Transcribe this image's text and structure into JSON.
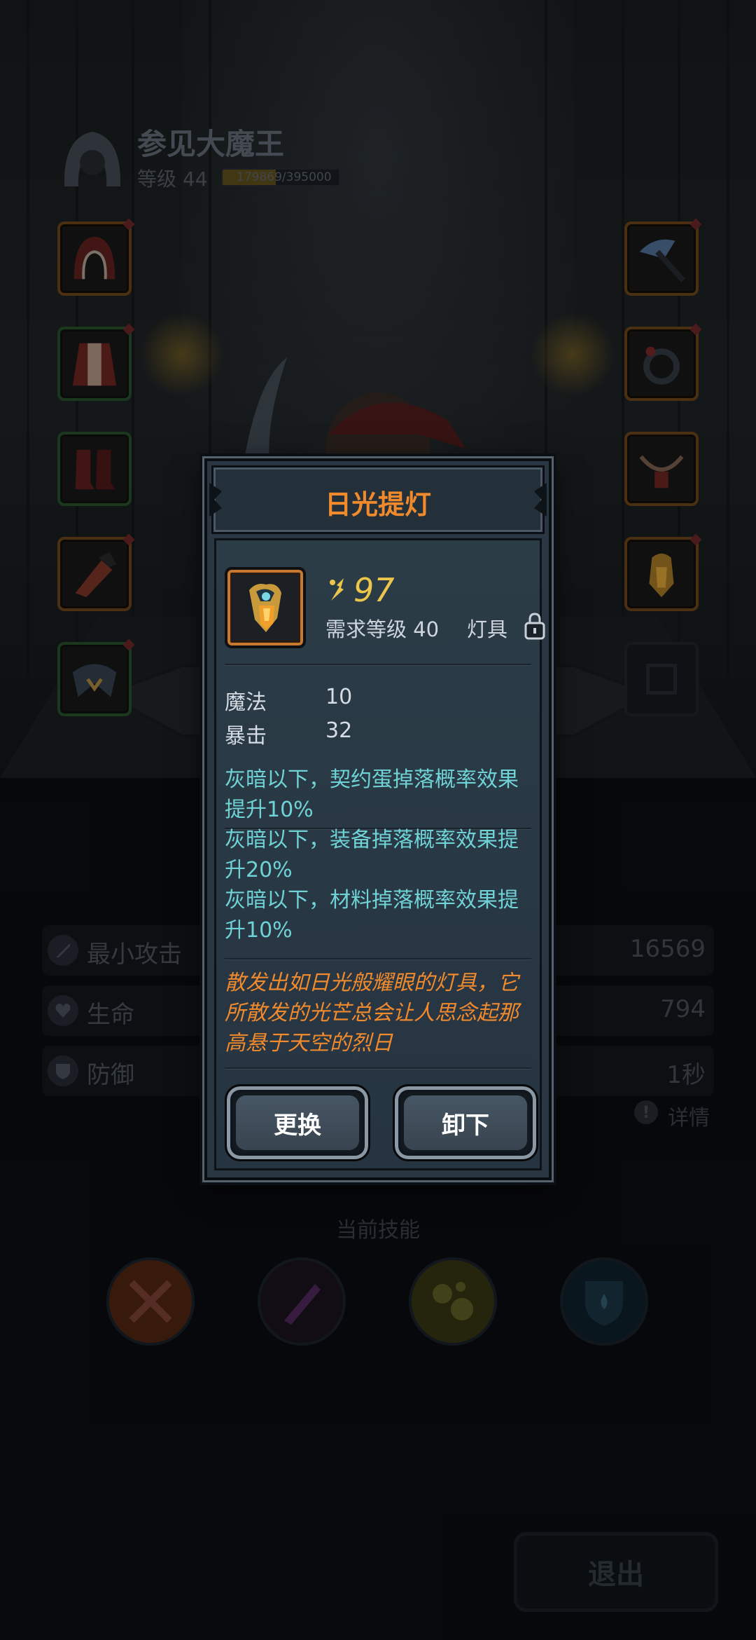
{
  "player": {
    "name": "参见大魔王",
    "level_label": "等级 44",
    "xp_text": "179869/395000",
    "xp_fraction": 0.455
  },
  "stats": [
    {
      "label": "最小攻击",
      "value": "16569",
      "icon": "sword-icon"
    },
    {
      "label": "生命",
      "value": "794",
      "icon": "heart-icon"
    },
    {
      "label": "防御",
      "value": "1秒",
      "icon": "shield-icon"
    }
  ],
  "detail_link": "详情",
  "skills_title": "当前技能",
  "exit_label": "退出",
  "modal": {
    "title": "日光提灯",
    "power": "97",
    "requirement": "需求等级 40",
    "item_type": "灯具",
    "attributes": [
      {
        "name": "魔法",
        "value": "10"
      },
      {
        "name": "暴击",
        "value": "32"
      }
    ],
    "effects": [
      "灰暗以下，契约蛋掉落概率效果提升10%",
      "灰暗以下，装备掉落概率效果提升20%",
      "灰暗以下，材料掉落概率效果提升10%"
    ],
    "description": "散发出如日光般耀眼的灯具，它所散发的光芒总会让人思念起那高悬于天空的烈日",
    "replace_label": "更换",
    "unequip_label": "卸下"
  },
  "colors": {
    "title_orange": "#f08a2c",
    "power_gold": "#ecc54a",
    "effect_cyan": "#6fd3d6",
    "desc_orange": "#f08a2c"
  }
}
